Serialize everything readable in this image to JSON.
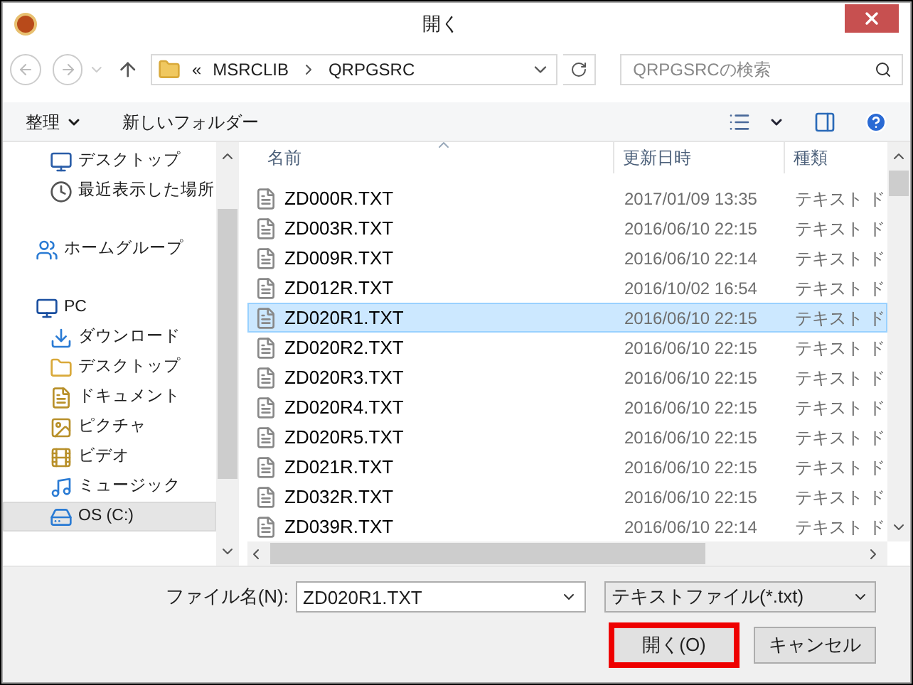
{
  "window": {
    "title": "開く"
  },
  "address": {
    "overflow": "«",
    "path": [
      "MSRCLIB",
      "QRPGSRC"
    ]
  },
  "search": {
    "placeholder": "QRPGSRCの検索"
  },
  "toolbar": {
    "organize": "整理",
    "new_folder": "新しいフォルダー"
  },
  "nav": [
    {
      "kind": "desktop",
      "label": "デスクトップ",
      "selected": false
    },
    {
      "kind": "recent",
      "label": "最近表示した場所",
      "selected": false
    },
    {
      "kind": "homegroup",
      "label": "ホームグループ",
      "selected": false
    },
    {
      "kind": "pc",
      "label": "PC",
      "selected": false,
      "children": [
        {
          "kind": "download",
          "label": "ダウンロード",
          "selected": false
        },
        {
          "kind": "desktop-folder",
          "label": "デスクトップ",
          "selected": false
        },
        {
          "kind": "documents",
          "label": "ドキュメント",
          "selected": false
        },
        {
          "kind": "pictures",
          "label": "ピクチャ",
          "selected": false
        },
        {
          "kind": "videos",
          "label": "ビデオ",
          "selected": false
        },
        {
          "kind": "music",
          "label": "ミュージック",
          "selected": false
        },
        {
          "kind": "drive",
          "label": "OS (C:)",
          "selected": true
        }
      ]
    }
  ],
  "table": {
    "columns": [
      "名前",
      "更新日時",
      "種類"
    ],
    "rows": [
      {
        "name": "ZD000R.TXT",
        "date": "2017/01/09 13:35",
        "type": "テキスト ド",
        "selected": false
      },
      {
        "name": "ZD003R.TXT",
        "date": "2016/06/10 22:15",
        "type": "テキスト ド",
        "selected": false
      },
      {
        "name": "ZD009R.TXT",
        "date": "2016/06/10 22:14",
        "type": "テキスト ド",
        "selected": false
      },
      {
        "name": "ZD012R.TXT",
        "date": "2016/10/02 16:54",
        "type": "テキスト ド",
        "selected": false
      },
      {
        "name": "ZD020R1.TXT",
        "date": "2016/06/10 22:15",
        "type": "テキスト ド",
        "selected": true
      },
      {
        "name": "ZD020R2.TXT",
        "date": "2016/06/10 22:15",
        "type": "テキスト ド",
        "selected": false
      },
      {
        "name": "ZD020R3.TXT",
        "date": "2016/06/10 22:15",
        "type": "テキスト ド",
        "selected": false
      },
      {
        "name": "ZD020R4.TXT",
        "date": "2016/06/10 22:15",
        "type": "テキスト ド",
        "selected": false
      },
      {
        "name": "ZD020R5.TXT",
        "date": "2016/06/10 22:15",
        "type": "テキスト ド",
        "selected": false
      },
      {
        "name": "ZD021R.TXT",
        "date": "2016/06/10 22:15",
        "type": "テキスト ド",
        "selected": false
      },
      {
        "name": "ZD032R.TXT",
        "date": "2016/06/10 22:15",
        "type": "テキスト ド",
        "selected": false
      },
      {
        "name": "ZD039R.TXT",
        "date": "2016/06/10 22:14",
        "type": "テキスト ド",
        "selected": false
      }
    ]
  },
  "filename": {
    "label": "ファイル名(N):",
    "value": "ZD020R1.TXT"
  },
  "filter": {
    "value": "テキストファイル(*.txt)"
  },
  "buttons": [
    {
      "label": "開く(O)",
      "highlighted": true
    },
    {
      "label": "キャンセル",
      "highlighted": false
    }
  ]
}
